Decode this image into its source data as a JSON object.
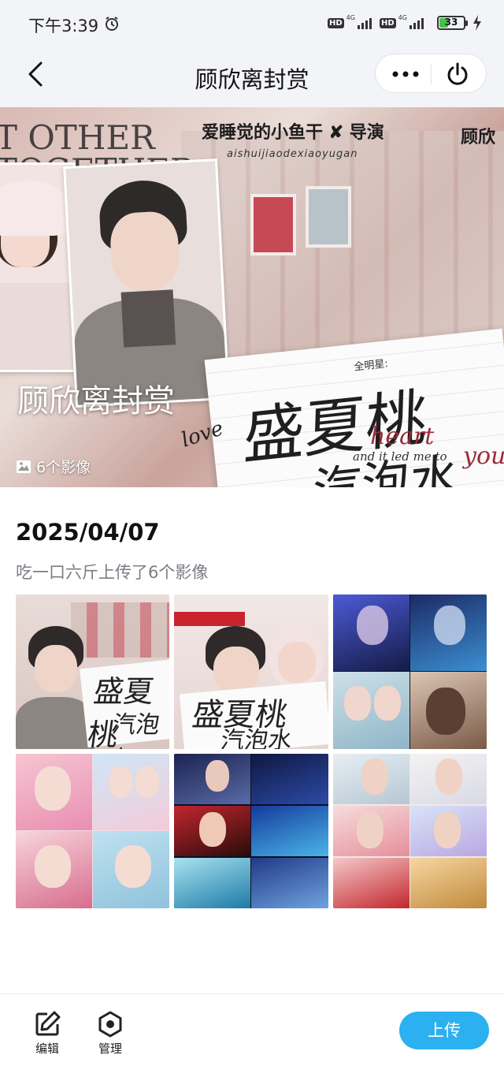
{
  "status": {
    "time": "下午3:39",
    "network1": "HD",
    "network1_type": "4G",
    "network2": "HD",
    "network2_type": "4G",
    "battery": "33",
    "battery_level": 0.33
  },
  "nav": {
    "title": "顾欣离封赏"
  },
  "hero": {
    "title": "顾欣离封赏",
    "count": "6个影像",
    "credit": "爱睡觉的小鱼干 ✘ 导演",
    "credit_sub": "aishuijiaodexiaoyugan",
    "credit_partial": "顾欣",
    "poster_line1": "盛夏桃",
    "poster_line2": "汽泡水",
    "poster_small": "全明星:",
    "bg_text": "T OTHER\nTOGETHER\nR"
  },
  "album": {
    "date": "2025/04/07",
    "uploader": "吃一口六斤上传了6个影像"
  },
  "toolbar": {
    "edit_label": "编辑",
    "manage_label": "管理",
    "upload_label": "上传"
  },
  "colors": {
    "accent": "#2bb0f0",
    "nav_bg": "#f3f4f8",
    "battery": "#43c24b"
  }
}
